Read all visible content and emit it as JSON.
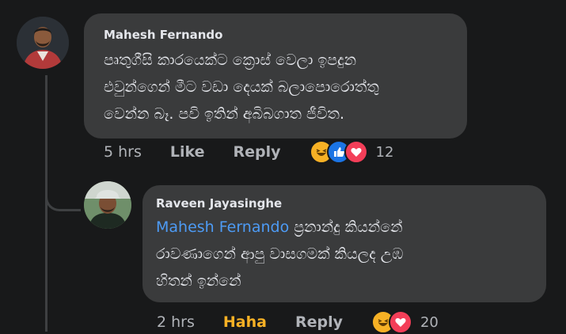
{
  "comments": [
    {
      "author": "Mahesh Fernando",
      "text_lines": [
        "පෘතුගීසි කාරයෙක්ට ක්‍රොස් වෙලා ඉපදුන",
        "එවුන්ගෙන් මීට වඩා දෙයක් බලාපොරොත්තු",
        "වෙන්න බෑ. පවි ඉතින් අබිබගාත ජීවිත."
      ],
      "time": "5 hrs",
      "like_label": "Like",
      "reply_label": "Reply",
      "reaction_icons": [
        "haha-icon",
        "like-icon",
        "love-icon"
      ],
      "reaction_count": "12"
    },
    {
      "author": "Raveen Jayasinghe",
      "mention": "Mahesh Fernando",
      "text_first": " ප්‍රනාන්දු කියන්නේ",
      "text_lines": [
        "රාවණාගෙන් ආපු වාසගමක් කියලද උඹ",
        "හිතන් ඉන්නේ"
      ],
      "time": "2 hrs",
      "like_label": "Haha",
      "reply_label": "Reply",
      "reaction_icons": [
        "haha-icon",
        "love-icon"
      ],
      "reaction_count": "20"
    }
  ],
  "colors": {
    "background": "#18191a",
    "bubble": "#3a3b3c",
    "mention": "#4d9bf5",
    "haha": "#f7b125",
    "like": "#1b74e4",
    "love": "#f33e58"
  }
}
